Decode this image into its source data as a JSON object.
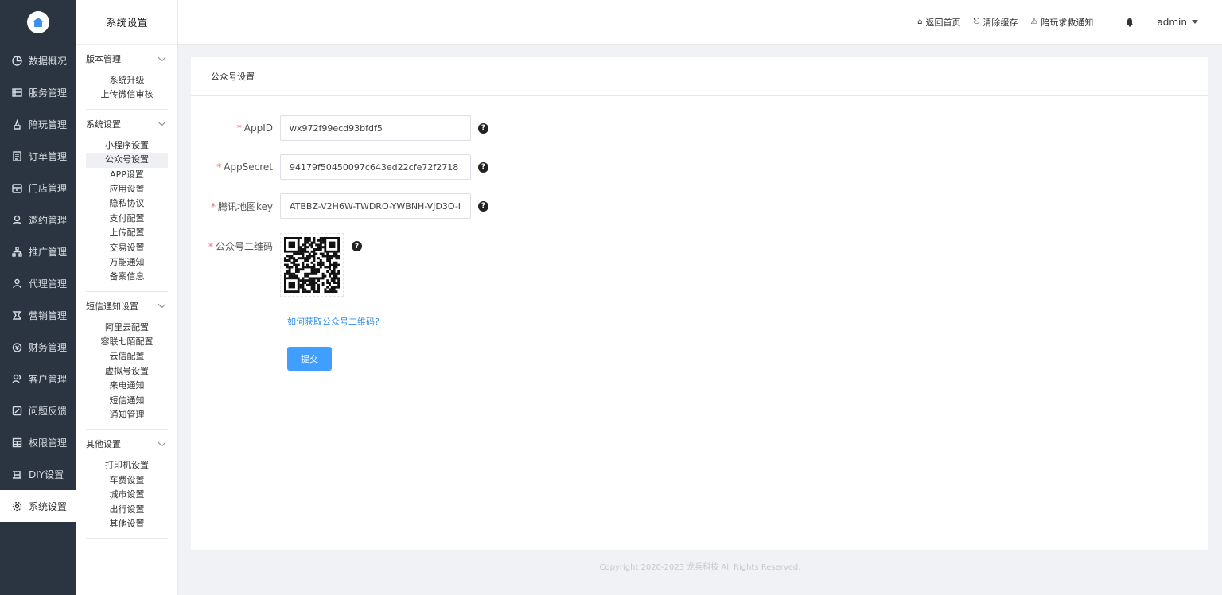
{
  "nav": {
    "logo_icon": "home-icon",
    "items": [
      {
        "label": "数据概况",
        "icon": "pie-chart-icon"
      },
      {
        "label": "服务管理",
        "icon": "service-icon"
      },
      {
        "label": "陪玩管理",
        "icon": "player-icon"
      },
      {
        "label": "订单管理",
        "icon": "order-icon"
      },
      {
        "label": "门店管理",
        "icon": "store-icon"
      },
      {
        "label": "邀约管理",
        "icon": "invite-icon"
      },
      {
        "label": "推广管理",
        "icon": "promotion-icon"
      },
      {
        "label": "代理管理",
        "icon": "agent-icon"
      },
      {
        "label": "营销管理",
        "icon": "marketing-icon"
      },
      {
        "label": "财务管理",
        "icon": "finance-icon"
      },
      {
        "label": "客户管理",
        "icon": "customer-icon"
      },
      {
        "label": "问题反馈",
        "icon": "feedback-icon"
      },
      {
        "label": "权限管理",
        "icon": "permission-icon"
      },
      {
        "label": "DIY设置",
        "icon": "diy-icon"
      },
      {
        "label": "系统设置",
        "icon": "settings-icon"
      }
    ]
  },
  "submenu": {
    "title": "系统设置",
    "groups": [
      {
        "title": "版本管理",
        "items": [
          "系统升级",
          "上传微信审核"
        ]
      },
      {
        "title": "系统设置",
        "items": [
          "小程序设置",
          "公众号设置",
          "APP设置",
          "应用设置",
          "隐私协议",
          "支付配置",
          "上传配置",
          "交易设置",
          "万能通知",
          "备案信息"
        ]
      },
      {
        "title": "短信通知设置",
        "items": [
          "阿里云配置",
          "容联七陌配置",
          "云信配置",
          "虚拟号设置",
          "来电通知",
          "短信通知",
          "通知管理"
        ]
      },
      {
        "title": "其他设置",
        "items": [
          "打印机设置",
          "车费设置",
          "城市设置",
          "出行设置",
          "其他设置"
        ]
      }
    ]
  },
  "header": {
    "links": [
      {
        "label": "返回首页",
        "icon": "home-icon"
      },
      {
        "label": "清除缓存",
        "icon": "broom-icon"
      },
      {
        "label": "陪玩求救通知",
        "icon": "alarm-icon"
      }
    ],
    "bell_icon": "bell-icon",
    "user": "admin"
  },
  "card": {
    "title": "公众号设置",
    "fields": [
      {
        "label": "AppID",
        "value": "wx972f99ecd93bfdf5"
      },
      {
        "label": "AppSecret",
        "value": "94179f50450097c643ed22cfe72f2718"
      },
      {
        "label": "腾讯地图key",
        "value": "ATBBZ-V2H6W-TWDRO-YWBNH-VJD3O-I"
      }
    ],
    "qr_label": "公众号二维码",
    "required_mark": "*",
    "help_mark": "?",
    "qr_help_link": "如何获取公众号二维码?",
    "submit_label": "提交"
  },
  "footer": {
    "text": "Copyright 2020-2023 龙兵科技 All Rights Reserved."
  },
  "colors": {
    "nav_bg": "#2b3541",
    "primary": "#409eff",
    "link": "#2d8cf0",
    "required": "#f56c6c"
  }
}
